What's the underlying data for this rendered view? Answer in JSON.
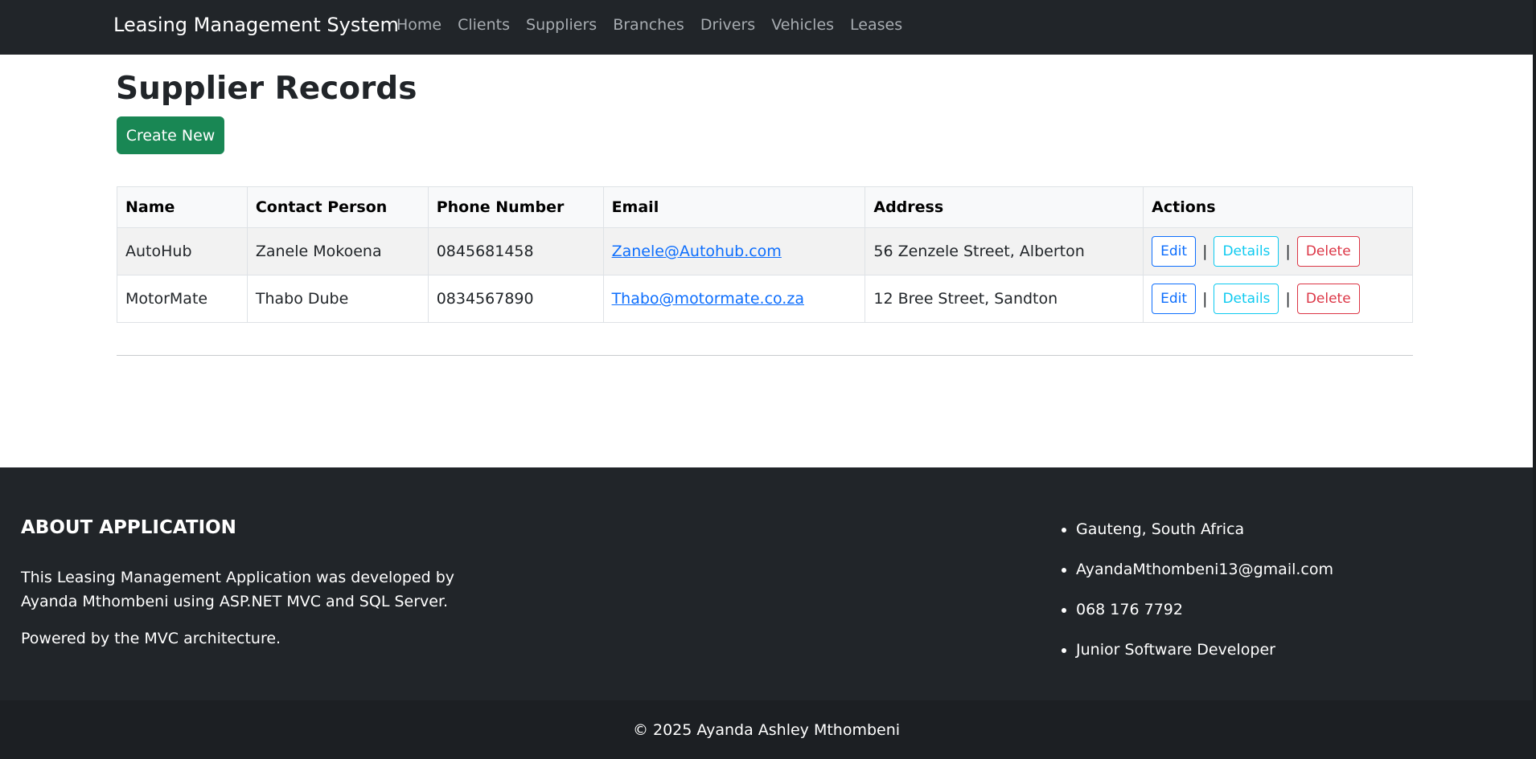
{
  "navbar": {
    "brand": "Leasing Management System",
    "links": [
      "Home",
      "Clients",
      "Suppliers",
      "Branches",
      "Drivers",
      "Vehicles",
      "Leases"
    ]
  },
  "main": {
    "title": "Supplier Records",
    "create_label": "Create New",
    "table": {
      "headers": [
        "Name",
        "Contact Person",
        "Phone Number",
        "Email",
        "Address",
        "Actions"
      ],
      "rows": [
        {
          "name": "AutoHub",
          "contact": "Zanele Mokoena",
          "phone": "0845681458",
          "email": "Zanele@Autohub.com",
          "address": "56 Zenzele Street, Alberton"
        },
        {
          "name": "MotorMate",
          "contact": "Thabo Dube",
          "phone": "0834567890",
          "email": "Thabo@motormate.co.za",
          "address": "12 Bree Street, Sandton"
        }
      ],
      "actions": {
        "edit": "Edit",
        "details": "Details",
        "delete": "Delete",
        "separator": "|"
      }
    }
  },
  "footer": {
    "about_title": "ABOUT APPLICATION",
    "about_text": "This Leasing Management Application was developed by Ayanda Mthombeni using ASP.NET MVC and SQL Server.",
    "powered": "Powered by the MVC architecture.",
    "contact": [
      "Gauteng, South Africa",
      "AyandaMthombeni13@gmail.com",
      "068 176 7792",
      "Junior Software Developer"
    ],
    "copyright": "© 2025 Ayanda Ashley Mthombeni"
  },
  "colors": {
    "navbar_bg": "#212529",
    "create_button": "#198754",
    "edit": "#0d6efd",
    "details": "#0dcaf0",
    "delete": "#dc3545",
    "link": "#0d6efd"
  }
}
